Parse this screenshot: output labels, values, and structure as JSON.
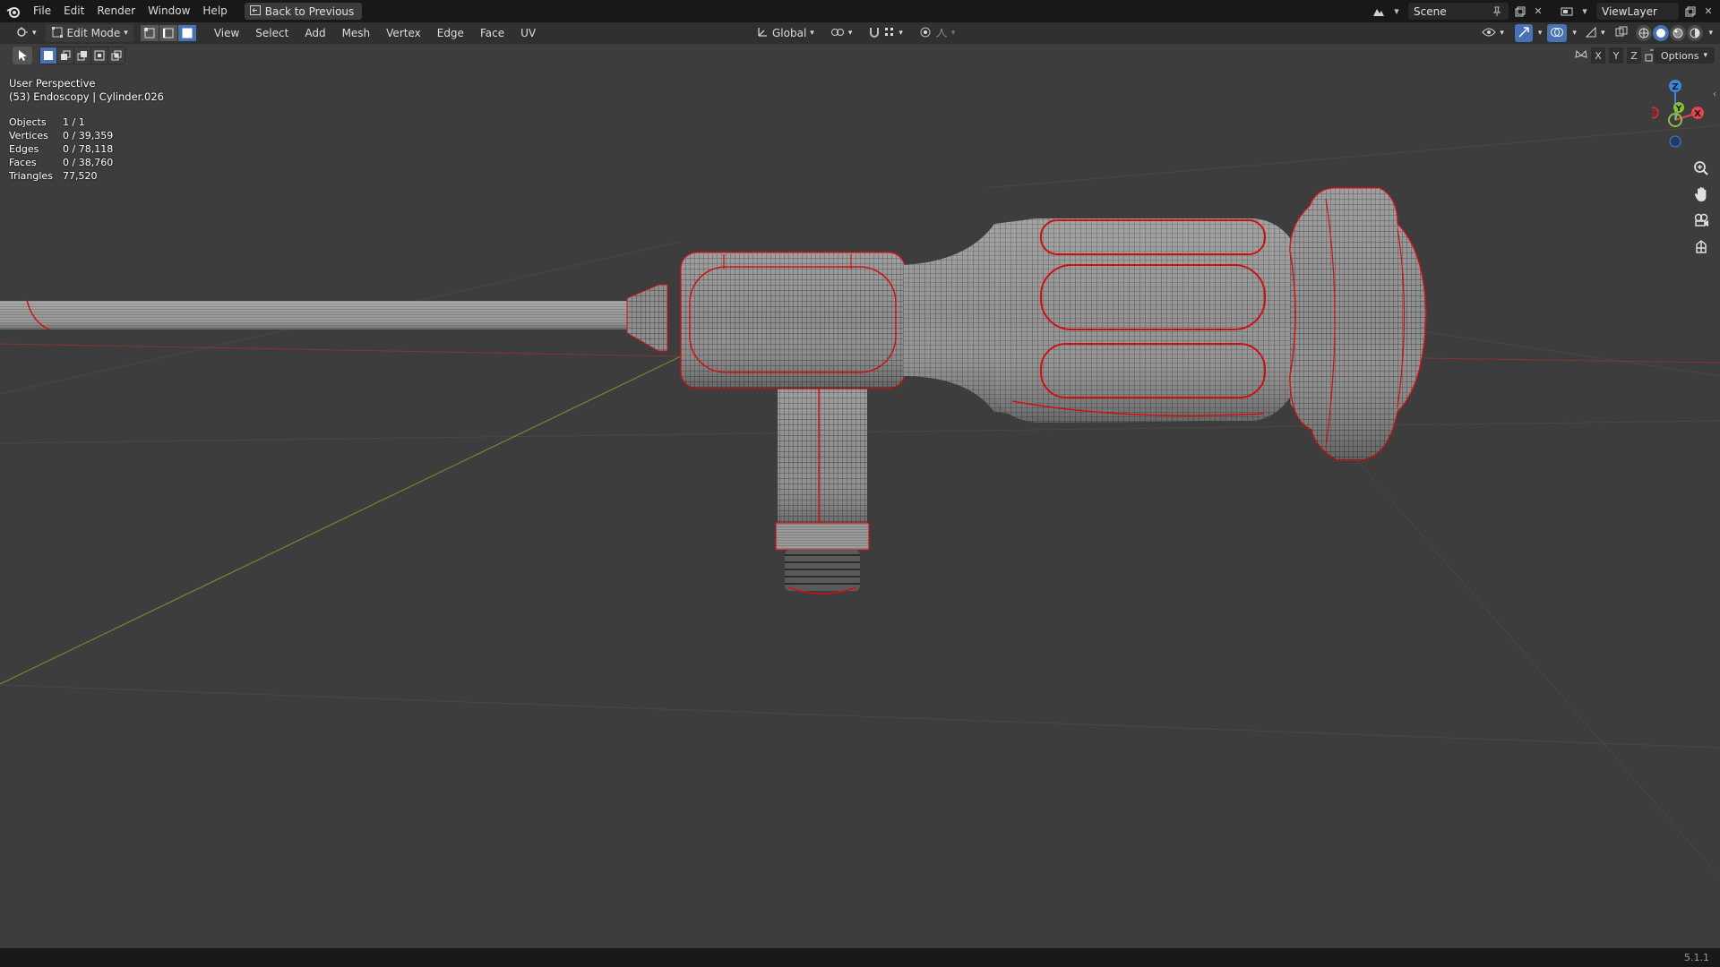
{
  "topbar": {
    "menus": [
      "File",
      "Edit",
      "Render",
      "Window",
      "Help"
    ],
    "back_button": "Back to Previous",
    "scene_name": "Scene",
    "view_layer_name": "ViewLayer"
  },
  "header": {
    "mode": "Edit Mode",
    "menus": [
      "View",
      "Select",
      "Add",
      "Mesh",
      "Vertex",
      "Edge",
      "Face",
      "UV"
    ],
    "transform_orientation": "Global",
    "mirror_axes": [
      "X",
      "Y",
      "Z"
    ],
    "options_label": "Options"
  },
  "overlay": {
    "perspective": "User Perspective",
    "object_info": "(53) Endoscopy | Cylinder.026",
    "stats": [
      {
        "label": "Objects",
        "value": "1 / 1"
      },
      {
        "label": "Vertices",
        "value": "0 / 39,359"
      },
      {
        "label": "Edges",
        "value": "0 / 78,118"
      },
      {
        "label": "Faces",
        "value": "0 / 38,760"
      },
      {
        "label": "Triangles",
        "value": "77,520"
      }
    ]
  },
  "gizmo": {
    "x": "X",
    "y": "Y",
    "z": "Z"
  },
  "colors": {
    "x_axis": "#e2434f",
    "y_axis": "#8bbd3c",
    "z_axis": "#3d85e0",
    "seam": "#d01010",
    "accent": "#4772b3"
  },
  "status": {
    "version": "5.1.1"
  }
}
